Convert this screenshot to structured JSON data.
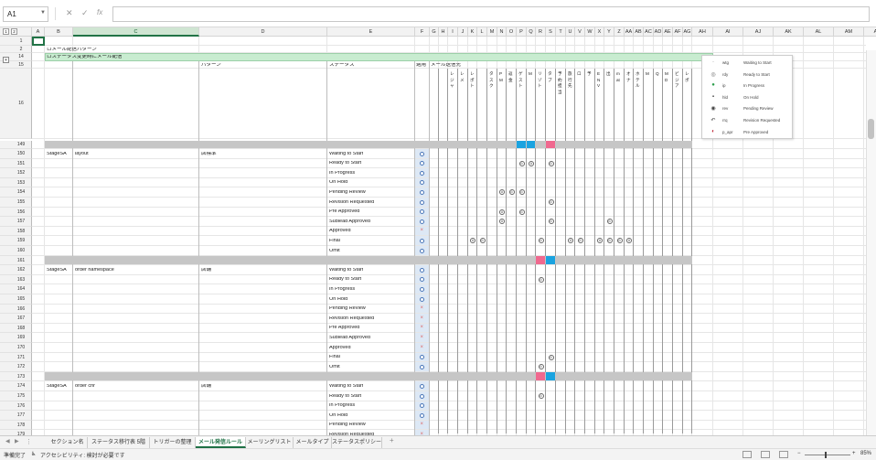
{
  "namebox": "A1",
  "formula_icons": {
    "cancel": "✕",
    "enter": "✓",
    "fx": "fx"
  },
  "group_levels": [
    "1",
    "2"
  ],
  "columns": [
    {
      "id": "A",
      "w": 14
    },
    {
      "id": "B",
      "w": 31
    },
    {
      "id": "C",
      "w": 138
    },
    {
      "id": "D",
      "w": 140
    },
    {
      "id": "E",
      "w": 96
    },
    {
      "id": "F",
      "w": 16
    },
    {
      "id": "G",
      "w": 10
    },
    {
      "id": "H",
      "w": 10
    },
    {
      "id": "I",
      "w": 11
    },
    {
      "id": "J",
      "w": 11
    },
    {
      "id": "K",
      "w": 10
    },
    {
      "id": "L",
      "w": 11
    },
    {
      "id": "M",
      "w": 11
    },
    {
      "id": "N",
      "w": 10
    },
    {
      "id": "O",
      "w": 11
    },
    {
      "id": "P",
      "w": 11
    },
    {
      "id": "Q",
      "w": 10
    },
    {
      "id": "R",
      "w": 11
    },
    {
      "id": "S",
      "w": 11
    },
    {
      "id": "T",
      "w": 11
    },
    {
      "id": "U",
      "w": 10
    },
    {
      "id": "V",
      "w": 11
    },
    {
      "id": "W",
      "w": 11
    },
    {
      "id": "X",
      "w": 10
    },
    {
      "id": "Y",
      "w": 11
    },
    {
      "id": "Z",
      "w": 11
    },
    {
      "id": "AA",
      "w": 10
    },
    {
      "id": "AB",
      "w": 11
    },
    {
      "id": "AC",
      "w": 11
    },
    {
      "id": "AD",
      "w": 10
    },
    {
      "id": "AE",
      "w": 11
    },
    {
      "id": "AF",
      "w": 11
    },
    {
      "id": "AG",
      "w": 10
    },
    {
      "id": "AH",
      "w": 23
    },
    {
      "id": "AI",
      "w": 33
    },
    {
      "id": "AJ",
      "w": 33
    },
    {
      "id": "AK",
      "w": 33
    },
    {
      "id": "AL",
      "w": 33
    },
    {
      "id": "AM",
      "w": 33
    },
    {
      "id": "AN",
      "w": 30
    }
  ],
  "top_rows": {
    "r2": "ロメール配信パターン",
    "r14": "ロステータス変更時にメール配信",
    "r15": {
      "pattern": "パターン",
      "status": "ステータス",
      "use": "適用",
      "dest": "メール送信先"
    }
  },
  "vertical_headers": [
    "",
    "",
    "レジャ",
    "レメ",
    "レポト",
    "",
    "タスク",
    "PM",
    "返金",
    "ゲスト",
    "M",
    "リゾト",
    "タブ",
    "予約担当",
    "旅行先",
    "ロ",
    "予",
    "ENV",
    "出",
    "mat",
    "オナ",
    "ホテル",
    "M",
    "Q",
    "MD",
    "ビジア",
    "レポ"
  ],
  "status_legend": [
    {
      "icon": "·",
      "code": "wtg",
      "name": "Waiting to Start",
      "color": "#666"
    },
    {
      "icon": "◎",
      "code": "rdy",
      "name": "Ready to Start",
      "color": "#666"
    },
    {
      "icon": "●",
      "code": "ip",
      "name": "In Progress",
      "color": "#2a9d4a"
    },
    {
      "icon": "▪",
      "code": "hld",
      "name": "On Hold",
      "color": "#444"
    },
    {
      "icon": "◉",
      "code": "rev",
      "name": "Pending Review",
      "color": "#444"
    },
    {
      "icon": "↶",
      "code": "rrq",
      "name": "Revision Requested",
      "color": "#444"
    },
    {
      "icon": "◐",
      "code": "p_apr",
      "name": "Pre Approved",
      "color": "#c02a3a"
    }
  ],
  "sections": [
    {
      "stage": "StageSA",
      "name": "layout",
      "pattern": "店標準",
      "bar": {
        "blue": [
          "P",
          "Q"
        ],
        "pink": [
          "S"
        ]
      },
      "rows": [
        {
          "n": "150",
          "status": "Waiting to Start",
          "use": "o",
          "marks": []
        },
        {
          "n": "151",
          "status": "Ready to Start",
          "use": "o",
          "marks": [
            "P",
            "Q",
            "S"
          ]
        },
        {
          "n": "152",
          "status": "In Progress",
          "use": "o",
          "marks": []
        },
        {
          "n": "153",
          "status": "On Hold",
          "use": "o",
          "marks": []
        },
        {
          "n": "154",
          "status": "Pending Review",
          "use": "o",
          "marks": [
            "N",
            "O",
            "P"
          ]
        },
        {
          "n": "155",
          "status": "Revision Requested",
          "use": "o",
          "marks": [
            "S"
          ]
        },
        {
          "n": "156",
          "status": "Pre Approved",
          "use": "o",
          "marks": [
            "N",
            "P"
          ]
        },
        {
          "n": "157",
          "status": "Sublead Approved",
          "use": "o",
          "marks": [
            "N",
            "S",
            "Y"
          ]
        },
        {
          "n": "158",
          "status": "Approved",
          "use": "x",
          "marks": []
        },
        {
          "n": "159",
          "status": "Final",
          "use": "o",
          "marks": [
            "K",
            "L",
            "R",
            "U",
            "V",
            "X",
            "Y",
            "Z",
            "AA"
          ]
        },
        {
          "n": "160",
          "status": "Omit",
          "use": "o",
          "marks": []
        }
      ]
    },
    {
      "stage": "StageSA",
      "name": "order namespace",
      "pattern": "店舗",
      "bar": {
        "blue": [
          "S"
        ],
        "pink": [
          "R"
        ]
      },
      "rows": [
        {
          "n": "162",
          "status": "Waiting to Start",
          "use": "o",
          "marks": []
        },
        {
          "n": "163",
          "status": "Ready to Start",
          "use": "o",
          "marks": [
            "R"
          ]
        },
        {
          "n": "164",
          "status": "In Progress",
          "use": "o",
          "marks": []
        },
        {
          "n": "165",
          "status": "On Hold",
          "use": "o",
          "marks": []
        },
        {
          "n": "166",
          "status": "Pending Review",
          "use": "x",
          "marks": []
        },
        {
          "n": "167",
          "status": "Revision Requested",
          "use": "x",
          "marks": []
        },
        {
          "n": "168",
          "status": "Pre Approved",
          "use": "x",
          "marks": []
        },
        {
          "n": "169",
          "status": "Sublead Approved",
          "use": "x",
          "marks": []
        },
        {
          "n": "170",
          "status": "Approved",
          "use": "x",
          "marks": []
        },
        {
          "n": "171",
          "status": "Final",
          "use": "o",
          "marks": [
            "S"
          ]
        },
        {
          "n": "172",
          "status": "Omit",
          "use": "o",
          "marks": [
            "R"
          ]
        }
      ]
    },
    {
      "stage": "StageSA",
      "name": "order chr",
      "pattern": "店舗",
      "bar": {
        "blue": [
          "S"
        ],
        "pink": [
          "R"
        ]
      },
      "rows": [
        {
          "n": "174",
          "status": "Waiting to Start",
          "use": "o",
          "marks": []
        },
        {
          "n": "175",
          "status": "Ready to Start",
          "use": "o",
          "marks": [
            "R"
          ]
        },
        {
          "n": "176",
          "status": "In Progress",
          "use": "o",
          "marks": []
        },
        {
          "n": "177",
          "status": "On Hold",
          "use": "o",
          "marks": []
        },
        {
          "n": "178",
          "status": "Pending Review",
          "use": "x",
          "marks": []
        },
        {
          "n": "179",
          "status": "Revision Requested",
          "use": "x",
          "marks": []
        }
      ]
    }
  ],
  "sep_rows": [
    "149",
    "161",
    "173"
  ],
  "row_labels_top": [
    "1",
    "2",
    "14",
    "15",
    "16"
  ],
  "tabs": [
    {
      "label": "セクション名",
      "active": false,
      "w": 44
    },
    {
      "label": "ステータス移行表 5階",
      "active": false,
      "w": 68
    },
    {
      "label": "トリガーの整理",
      "active": false,
      "w": 50
    },
    {
      "label": "メール発信ルール",
      "active": true,
      "w": 55
    },
    {
      "label": "メーリングリスト",
      "active": false,
      "w": 52
    },
    {
      "label": "メールタイプ",
      "active": false,
      "w": 42
    },
    {
      "label": "ステータスポリシー",
      "active": false,
      "w": 55
    }
  ],
  "tab_nav": {
    "prev": "◀",
    "next": "▶",
    "add": "+",
    "more": "⋮"
  },
  "status": {
    "ready": "準備完了",
    "access_icon": "♿",
    "accessibility": "アクセシビリティ: 検討が必要です",
    "zoom": "85%",
    "minus": "−",
    "plus": "+"
  }
}
